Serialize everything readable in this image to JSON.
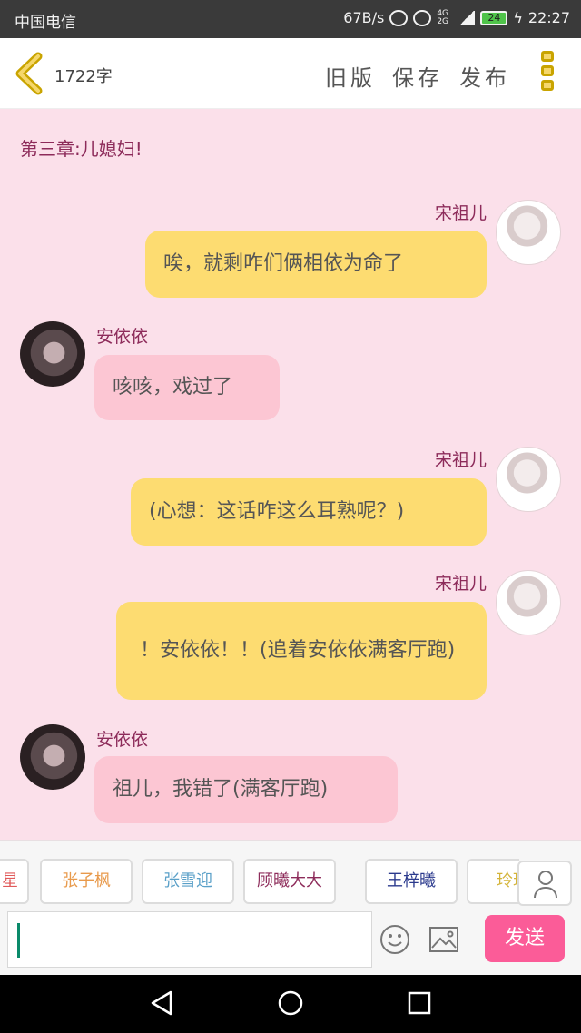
{
  "status_bar": {
    "carrier": "中国电信",
    "speed": "67B/s",
    "network": "4G 2G",
    "battery": "24",
    "time": "22:27"
  },
  "header": {
    "word_count": "1722字",
    "old_version": "旧版",
    "save": "保存",
    "publish": "发布"
  },
  "chapter_title": "第三章:儿媳妇!",
  "messages": [
    {
      "speaker": "宋祖儿",
      "text": "唉，就剩咋们俩相依为命了"
    },
    {
      "speaker": "安依依",
      "text": "咳咳，戏过了"
    },
    {
      "speaker": "宋祖儿",
      "text": "(心想：这话咋这么耳熟呢？)"
    },
    {
      "speaker": "宋祖儿",
      "text": "！安依依！！(追着安依依满客厅跑)"
    },
    {
      "speaker": "安依依",
      "text": "祖儿，我错了(满客厅跑)"
    }
  ],
  "characters": [
    {
      "name": "星",
      "color": "#e05a5a"
    },
    {
      "name": "张子枫",
      "color": "#e89a4c"
    },
    {
      "name": "张雪迎",
      "color": "#5aa0c8"
    },
    {
      "name": "顾曦大大",
      "color": "#8d2b5a"
    },
    {
      "name": "王梓曦",
      "color": "#2b3a8d"
    },
    {
      "name": "玲玲",
      "color": "#d4b43a"
    }
  ],
  "composer": {
    "input_value": "",
    "send_label": "发送"
  }
}
